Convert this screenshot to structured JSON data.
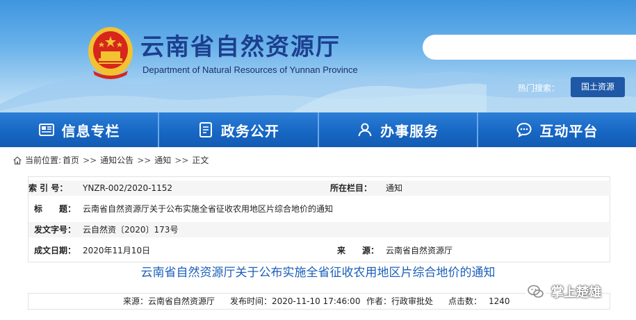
{
  "header": {
    "title": "云南省自然资源厅",
    "subtitle": "Department of Natural Resources of Yunnan Province",
    "search_placeholder": "",
    "hot_search_label": "热门搜索：",
    "hot_search_button": "国土资源"
  },
  "nav": {
    "items": [
      {
        "label": "信息专栏",
        "icon": "newspaper-icon"
      },
      {
        "label": "政务公开",
        "icon": "document-icon"
      },
      {
        "label": "办事服务",
        "icon": "user-icon"
      },
      {
        "label": "互动平台",
        "icon": "chat-icon"
      }
    ]
  },
  "breadcrumb": {
    "prefix": "当前位置:",
    "items": [
      "首页",
      "通知公告",
      "通知",
      "正文"
    ],
    "separator": ">>"
  },
  "info": {
    "index_label": "索 引 号：",
    "index_value": "YNZR-002/2020-1152",
    "column_label": "所在栏目：",
    "column_value": "通知",
    "title_label": "标　　题：",
    "title_value": "云南省自然资源厅关于公布实施全省征收农用地区片综合地价的通知",
    "doc_no_label": "发文字号：",
    "doc_no_value": "云自然资〔2020〕173号",
    "date_label": "成文日期：",
    "date_value": "2020年11月10日",
    "source_label": "来　　源：",
    "source_value": "云南省自然资源厅"
  },
  "article": {
    "title": "云南省自然资源厅关于公布实施全省征收农用地区片综合地价的通知",
    "meta_source": "来源：云南省自然资源厅",
    "meta_time": "发布时间：2020-11-10 17:46:00",
    "meta_author": "作者：行政审批处",
    "meta_clicks_label": "点击数：",
    "meta_clicks_value": "1240"
  },
  "watermark": {
    "text": "掌上楚雄"
  },
  "colors": {
    "nav_blue": "#1767c4",
    "title_blue": "#1c3f8e",
    "article_title_blue": "#1b5fb9",
    "emblem_red": "#d7261c",
    "emblem_gold": "#f2c230"
  }
}
